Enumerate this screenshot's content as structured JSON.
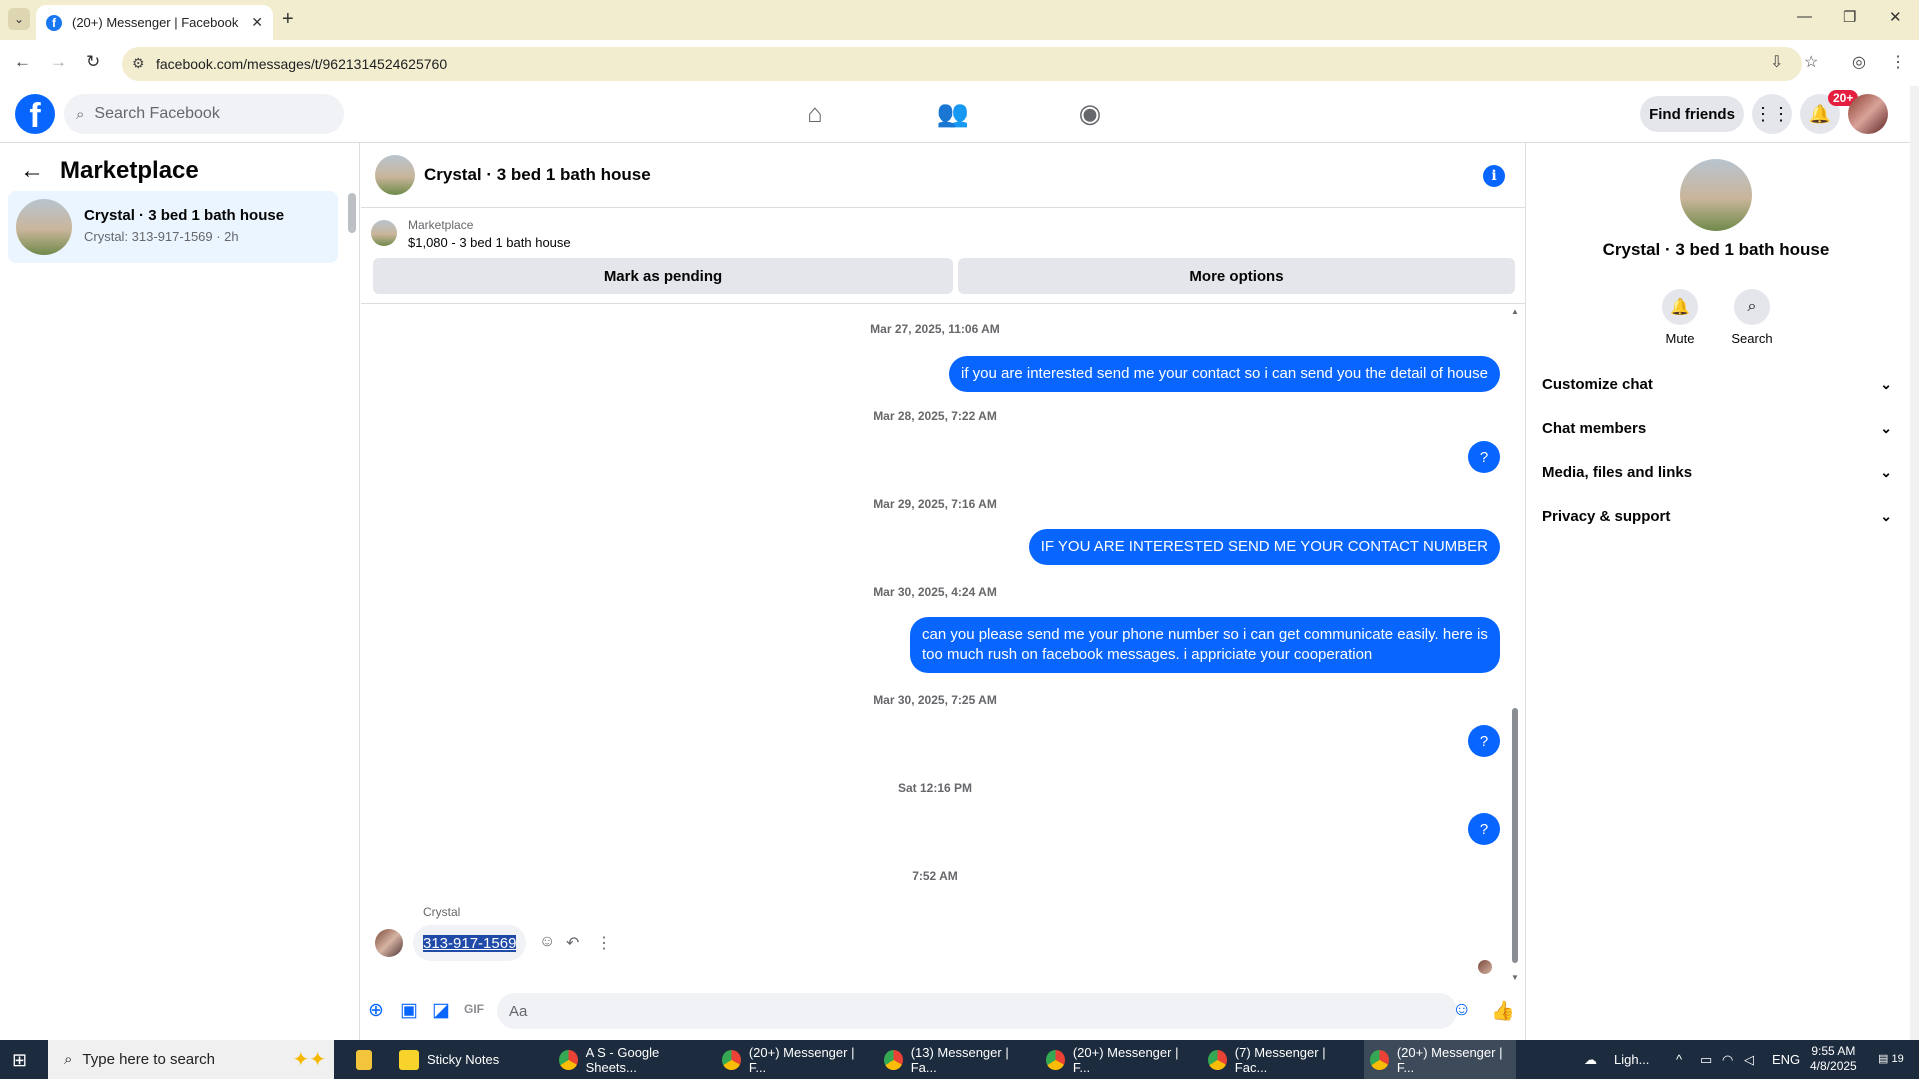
{
  "browser": {
    "tab_title": "(20+) Messenger | Facebook",
    "tab_close": "✕",
    "new_tab": "+",
    "url": "facebook.com/messages/t/9621314524625760"
  },
  "fb": {
    "logo": "f",
    "search_placeholder": "Search Facebook",
    "find_friends": "Find friends",
    "notif_badge": "20+"
  },
  "left": {
    "title": "Marketplace",
    "conversation": {
      "name": "Crystal · 3 bed 1 bath house",
      "preview": "Crystal: 313-917-1569 · 2h"
    }
  },
  "chat": {
    "header_name": "Crystal · 3 bed 1 bath house",
    "marketplace_label": "Marketplace",
    "listing": "$1,080 - 3 bed 1 bath house",
    "mark_pending": "Mark as pending",
    "more_options": "More options",
    "messages": [
      {
        "ts": "Mar 27, 2025, 11:06 AM",
        "text": "if you are interested send me your contact so i can send you the detail of house"
      },
      {
        "ts": "Mar 28, 2025, 7:22 AM",
        "text": "?"
      },
      {
        "ts": "Mar 29, 2025, 7:16 AM",
        "text": "IF YOU ARE INTERESTED SEND ME YOUR CONTACT NUMBER"
      },
      {
        "ts": "Mar 30, 2025, 4:24 AM",
        "text": "can you please send me your phone number so i can get communicate easily. here is too much rush on facebook messages. i appriciate your cooperation"
      },
      {
        "ts": "Mar 30, 2025, 7:25 AM",
        "text": "?"
      },
      {
        "ts": "Sat 12:16 PM",
        "text": "?"
      },
      {
        "ts": "7:52 AM"
      }
    ],
    "incoming_sender": "Crystal",
    "incoming_text": "313-917-1569",
    "composer_placeholder": "Aa"
  },
  "right": {
    "name": "Crystal · 3 bed 1 bath house",
    "mute": "Mute",
    "search": "Search",
    "rows": [
      "Customize chat",
      "Chat members",
      "Media, files and links",
      "Privacy & support"
    ]
  },
  "taskbar": {
    "search_placeholder": "Type here to search",
    "apps": [
      "Sticky Notes",
      "A S - Google Sheets...",
      "(20+) Messenger | F...",
      "(13) Messenger | Fa...",
      "(20+) Messenger | F...",
      "(7) Messenger | Fac...",
      "(20+) Messenger | F..."
    ],
    "weather": "Ligh...",
    "lang": "ENG",
    "time": "9:55 AM",
    "date": "4/8/2025",
    "notif_count": "19"
  }
}
